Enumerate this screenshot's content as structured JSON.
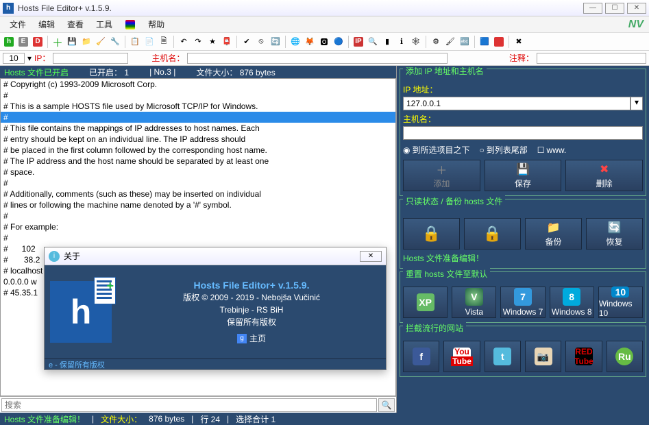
{
  "window": {
    "title": "Hosts File Editor+ v.1.5.9."
  },
  "menu": {
    "file": "文件",
    "edit": "编辑",
    "view": "查看",
    "tools": "工具",
    "help": "帮助"
  },
  "fieldbar": {
    "num": "10",
    "ip_label": "IP：",
    "host_label": "主机名：",
    "comment_label": "注释："
  },
  "statusline": {
    "hosts_on": "Hosts 文件已开启",
    "opened": "已开启：",
    "opened_n": "1",
    "no_label": "No.3",
    "size_label": "文件大小：",
    "size": "876 bytes"
  },
  "editor_lines": [
    "# Copyright (c) 1993-2009 Microsoft Corp.",
    "#",
    "# This is a sample HOSTS file used by Microsoft TCP/IP for Windows.",
    "#",
    "# This file contains the mappings of IP addresses to host names. Each",
    "# entry should be kept on an individual line. The IP address should",
    "# be placed in the first column followed by the corresponding host name.",
    "# The IP address and the host name should be separated by at least one",
    "# space.",
    "#",
    "# Additionally, comments (such as these) may be inserted on individual",
    "# lines or following the machine name denoted by a '#' symbol.",
    "#",
    "# For example:",
    "#",
    "#      102",
    "#       38.2",
    "",
    "# localhost",
    "",
    "0.0.0.0 w",
    "",
    "# 45.35.1"
  ],
  "selected_line_index": 3,
  "search": {
    "placeholder": "搜索"
  },
  "right": {
    "add_title": "添加 IP 地址和主机名",
    "ip_label": "IP 地址：",
    "ip_value": "127.0.0.1",
    "host_label": "主机名：",
    "radio_under": "到所选项目之下",
    "radio_end": "到列表尾部",
    "chk_www": "www.",
    "btn_add": "添加",
    "btn_save": "保存",
    "btn_delete": "删除",
    "readonly_title": "只读状态 / 备份 hosts 文件",
    "btn_backup": "备份",
    "btn_restore": "恢复",
    "ready_msg": "Hosts 文件准备编辑！",
    "reset_title": "重置 hosts 文件至默认",
    "os": {
      "xp": "",
      "vista": "Vista",
      "w7": "Windows 7",
      "w8": "Windows 8",
      "w10": "Windows 10"
    },
    "block_title": "拦截流行的网站",
    "sites": {
      "fb": "f",
      "yt": "You",
      "yt2": "Tube",
      "tw": "t",
      "ig": "📷",
      "rt": "RED",
      "rt2": "Tube",
      "ru": "Ru"
    }
  },
  "about": {
    "title": "关于",
    "app": "Hosts File Editor+ v.1.5.9.",
    "copyright": "版权 © 2009 - 2019 - Nebojša Vučinić",
    "location": "Trebinje - RS BiH",
    "rights": "保留所有版权",
    "homepage": "主页",
    "status": "e - 保留所有版权"
  },
  "bottom": {
    "ready": "Hosts 文件准备编辑！",
    "size_label": "文件大小：",
    "size": "876 bytes",
    "line_label": "行 24",
    "sel_label": "选择合计 1"
  }
}
